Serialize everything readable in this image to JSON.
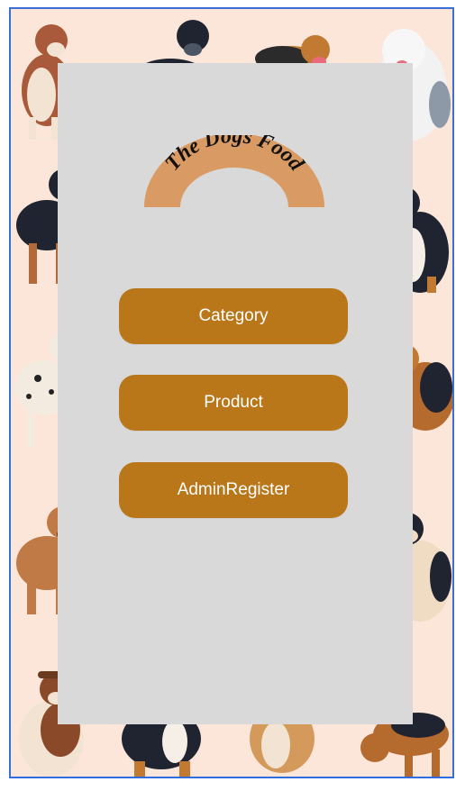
{
  "logo": {
    "text": "The Dogs Food"
  },
  "buttons": [
    {
      "label": "Category"
    },
    {
      "label": "Product"
    },
    {
      "label": "AdminRegister"
    }
  ],
  "colors": {
    "background": "#fce6da",
    "panel": "#d9d9d9",
    "button": "#b9771a",
    "logo_band": "#d99a63",
    "frame_border": "#3b6fd6"
  }
}
